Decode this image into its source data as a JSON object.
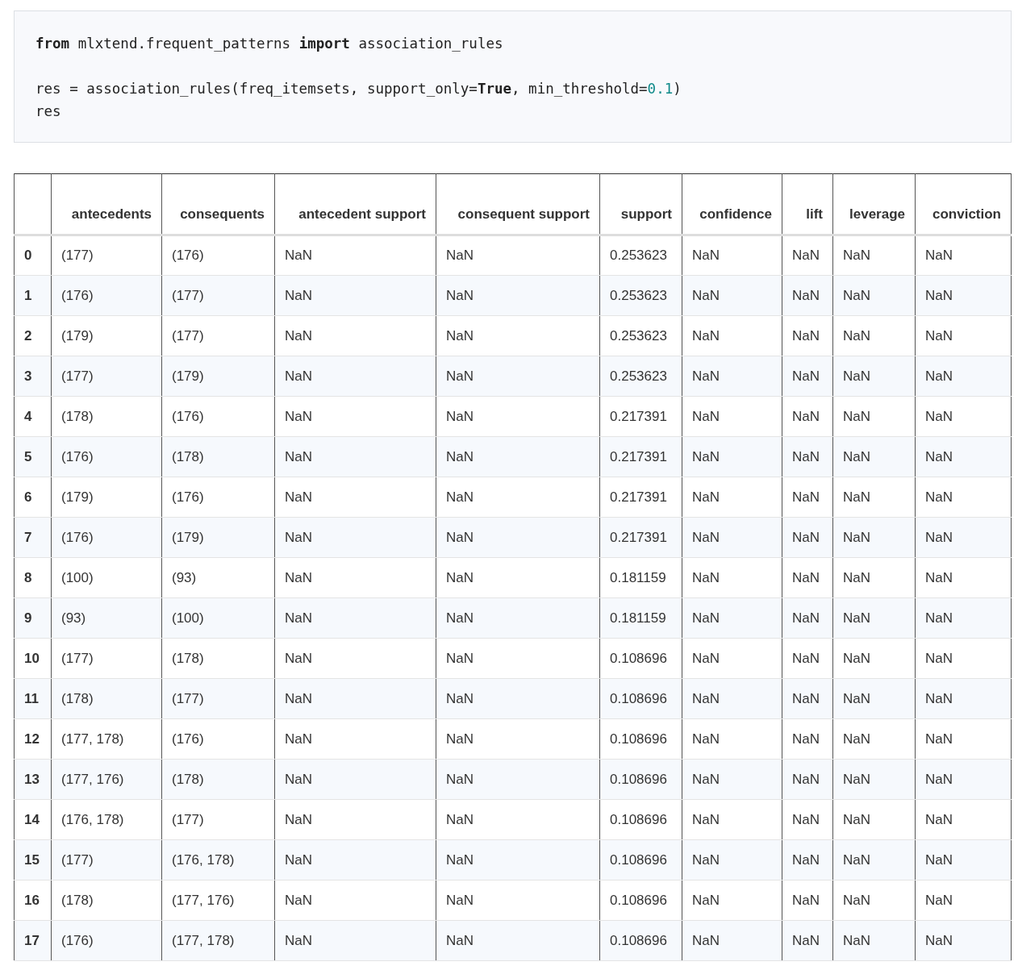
{
  "code": {
    "blocks": [
      [
        [
          {
            "text": "from",
            "kind": "keyword"
          },
          {
            "text": " mlxtend.frequent_patterns ",
            "kind": "plain"
          },
          {
            "text": "import",
            "kind": "keyword"
          },
          {
            "text": " association_rules",
            "kind": "plain"
          }
        ]
      ],
      [
        [
          {
            "text": "res = association_rules(freq_itemsets, support_only=",
            "kind": "plain"
          },
          {
            "text": "True",
            "kind": "keyword"
          },
          {
            "text": ", min_threshold=",
            "kind": "plain"
          },
          {
            "text": "0.1",
            "kind": "number"
          },
          {
            "text": ")",
            "kind": "plain"
          }
        ],
        [
          {
            "text": "res",
            "kind": "plain"
          }
        ]
      ]
    ]
  },
  "table": {
    "columns": [
      null,
      "antecedents",
      "consequents",
      "antecedent support",
      "consequent support",
      "support",
      "confidence",
      "lift",
      "leverage",
      "conviction"
    ],
    "rows": [
      [
        "0",
        "(177)",
        "(176)",
        "NaN",
        "NaN",
        "0.253623",
        "NaN",
        "NaN",
        "NaN",
        "NaN"
      ],
      [
        "1",
        "(176)",
        "(177)",
        "NaN",
        "NaN",
        "0.253623",
        "NaN",
        "NaN",
        "NaN",
        "NaN"
      ],
      [
        "2",
        "(179)",
        "(177)",
        "NaN",
        "NaN",
        "0.253623",
        "NaN",
        "NaN",
        "NaN",
        "NaN"
      ],
      [
        "3",
        "(177)",
        "(179)",
        "NaN",
        "NaN",
        "0.253623",
        "NaN",
        "NaN",
        "NaN",
        "NaN"
      ],
      [
        "4",
        "(178)",
        "(176)",
        "NaN",
        "NaN",
        "0.217391",
        "NaN",
        "NaN",
        "NaN",
        "NaN"
      ],
      [
        "5",
        "(176)",
        "(178)",
        "NaN",
        "NaN",
        "0.217391",
        "NaN",
        "NaN",
        "NaN",
        "NaN"
      ],
      [
        "6",
        "(179)",
        "(176)",
        "NaN",
        "NaN",
        "0.217391",
        "NaN",
        "NaN",
        "NaN",
        "NaN"
      ],
      [
        "7",
        "(176)",
        "(179)",
        "NaN",
        "NaN",
        "0.217391",
        "NaN",
        "NaN",
        "NaN",
        "NaN"
      ],
      [
        "8",
        "(100)",
        "(93)",
        "NaN",
        "NaN",
        "0.181159",
        "NaN",
        "NaN",
        "NaN",
        "NaN"
      ],
      [
        "9",
        "(93)",
        "(100)",
        "NaN",
        "NaN",
        "0.181159",
        "NaN",
        "NaN",
        "NaN",
        "NaN"
      ],
      [
        "10",
        "(177)",
        "(178)",
        "NaN",
        "NaN",
        "0.108696",
        "NaN",
        "NaN",
        "NaN",
        "NaN"
      ],
      [
        "11",
        "(178)",
        "(177)",
        "NaN",
        "NaN",
        "0.108696",
        "NaN",
        "NaN",
        "NaN",
        "NaN"
      ],
      [
        "12",
        "(177, 178)",
        "(176)",
        "NaN",
        "NaN",
        "0.108696",
        "NaN",
        "NaN",
        "NaN",
        "NaN"
      ],
      [
        "13",
        "(177, 176)",
        "(178)",
        "NaN",
        "NaN",
        "0.108696",
        "NaN",
        "NaN",
        "NaN",
        "NaN"
      ],
      [
        "14",
        "(176, 178)",
        "(177)",
        "NaN",
        "NaN",
        "0.108696",
        "NaN",
        "NaN",
        "NaN",
        "NaN"
      ],
      [
        "15",
        "(177)",
        "(176, 178)",
        "NaN",
        "NaN",
        "0.108696",
        "NaN",
        "NaN",
        "NaN",
        "NaN"
      ],
      [
        "16",
        "(178)",
        "(177, 176)",
        "NaN",
        "NaN",
        "0.108696",
        "NaN",
        "NaN",
        "NaN",
        "NaN"
      ],
      [
        "17",
        "(176)",
        "(177, 178)",
        "NaN",
        "NaN",
        "0.108696",
        "NaN",
        "NaN",
        "NaN",
        "NaN"
      ]
    ]
  }
}
